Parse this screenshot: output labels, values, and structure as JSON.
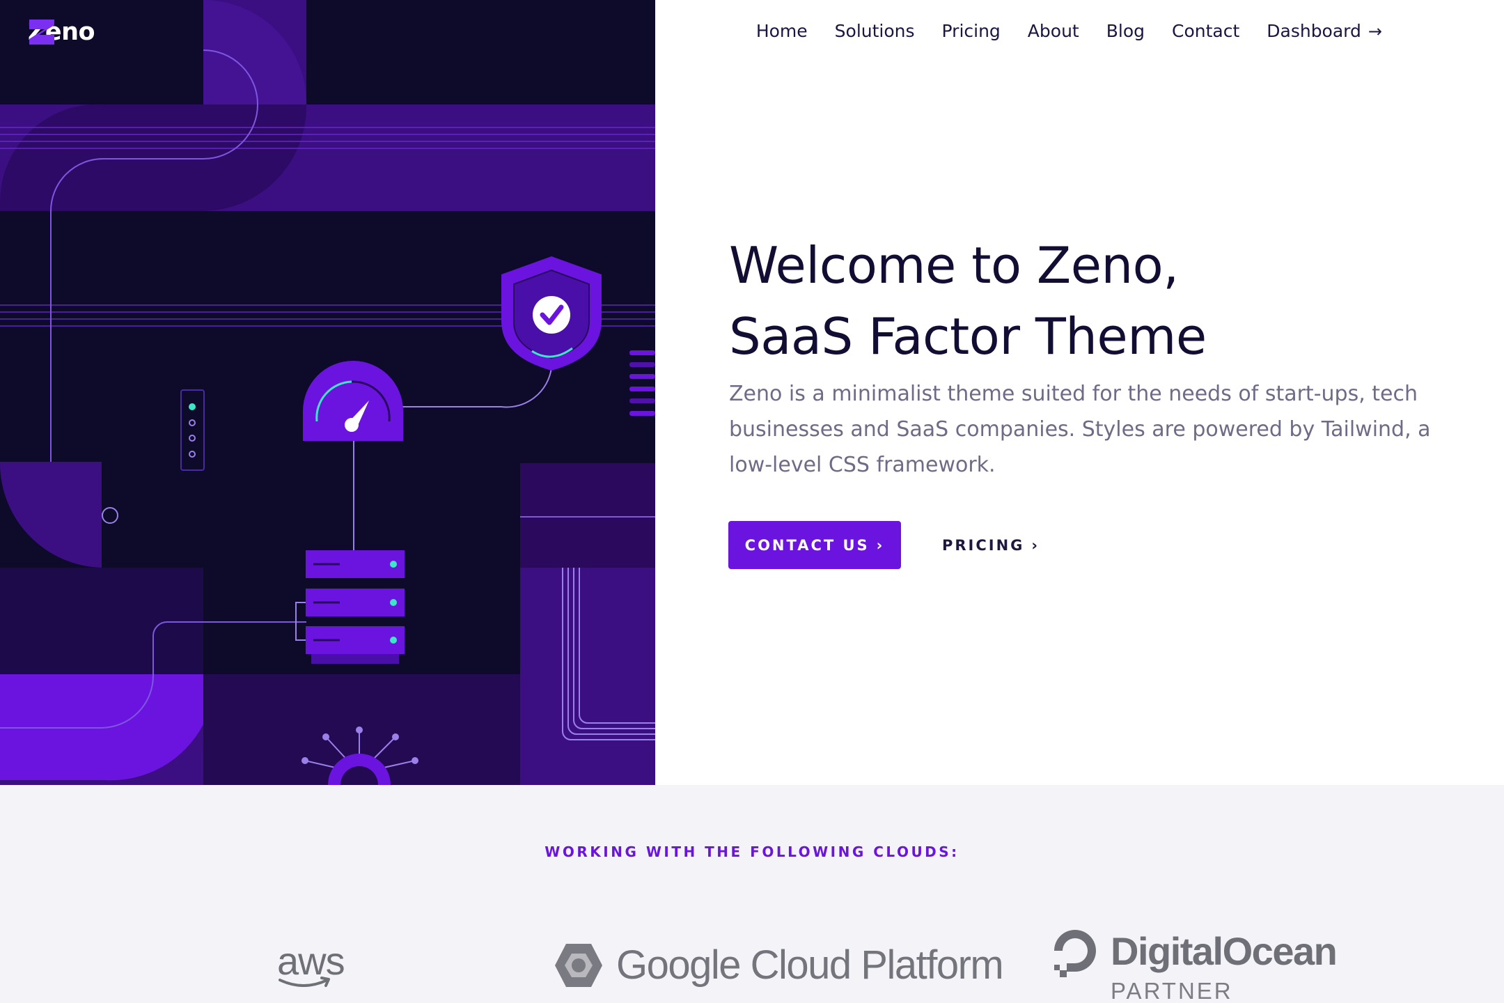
{
  "brand": {
    "name": "Zeno"
  },
  "nav": {
    "items": [
      {
        "label": "Home"
      },
      {
        "label": "Solutions"
      },
      {
        "label": "Pricing"
      },
      {
        "label": "About"
      },
      {
        "label": "Blog"
      },
      {
        "label": "Contact"
      },
      {
        "label": "Dashboard",
        "icon": "arrow-right-icon"
      }
    ]
  },
  "hero": {
    "title_line1": "Welcome to Zeno,",
    "title_line2": "SaaS Factor Theme",
    "lead": "Zeno is a minimalist theme suited for the needs of start-ups, tech businesses and SaaS companies. Styles are powered by Tailwind, a low-level CSS framework.",
    "primary_cta": "CONTACT US",
    "secondary_cta": "PRICING"
  },
  "clouds": {
    "title": "WORKING WITH THE FOLLOWING CLOUDS:",
    "aws": "aws",
    "gcp": "Google Cloud Platform",
    "do_name": "DigitalOcean",
    "do_sub": "PARTNER"
  },
  "colors": {
    "accent": "#6b14e0",
    "dark": "#0d0a2a",
    "purple": "#3b0f82",
    "teal": "#3de6c8"
  }
}
